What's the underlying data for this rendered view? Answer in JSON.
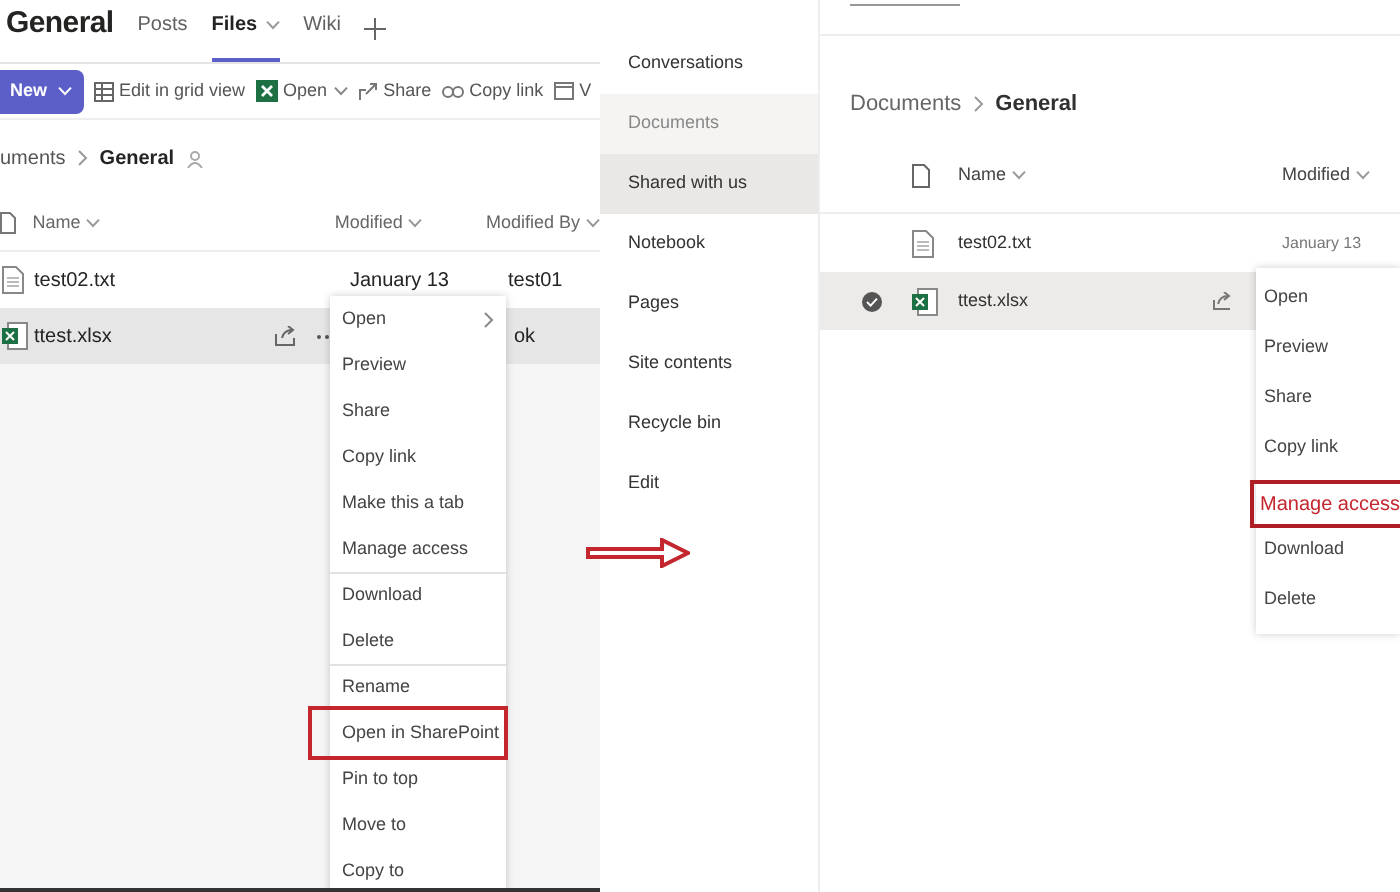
{
  "teams_view": {
    "channel": "General",
    "tabs": [
      {
        "label": "Posts",
        "selected": false,
        "has_menu": false
      },
      {
        "label": "Files",
        "selected": true,
        "has_menu": true
      },
      {
        "label": "Wiki",
        "selected": false,
        "has_menu": false
      }
    ],
    "toolbar": [
      {
        "kind": "primary",
        "label": "New",
        "has_menu": true
      },
      {
        "kind": "grid",
        "label": "Edit in grid view",
        "has_menu": false
      },
      {
        "kind": "excel",
        "label": "Open",
        "has_menu": true
      },
      {
        "kind": "share",
        "label": "Share",
        "has_menu": false
      },
      {
        "kind": "link",
        "label": "Copy link",
        "has_menu": false
      },
      {
        "kind": "window",
        "label": "V",
        "has_menu": false
      }
    ],
    "breadcrumb": {
      "parent": "uments",
      "current": "General"
    },
    "columns": [
      "Name",
      "Modified",
      "Modified By"
    ],
    "rows": [
      {
        "kind": "text",
        "name": "test02.txt",
        "modified": "January 13",
        "modified_by": "test01",
        "selected": false
      },
      {
        "kind": "excel",
        "name": "ttest.xlsx",
        "modified_by": "ok",
        "selected": true
      }
    ],
    "context_menu": [
      {
        "label": "Open",
        "submenu": true,
        "divider_before": false,
        "highlighted": false
      },
      {
        "label": "Preview",
        "submenu": false,
        "divider_before": false,
        "highlighted": false
      },
      {
        "label": "Share",
        "submenu": false,
        "divider_before": false,
        "highlighted": false
      },
      {
        "label": "Copy link",
        "submenu": false,
        "divider_before": false,
        "highlighted": false
      },
      {
        "label": "Make this a tab",
        "submenu": false,
        "divider_before": false,
        "highlighted": false
      },
      {
        "label": "Manage access",
        "submenu": false,
        "divider_before": false,
        "highlighted": false
      },
      {
        "label": "Download",
        "submenu": false,
        "divider_before": true,
        "highlighted": false
      },
      {
        "label": "Delete",
        "submenu": false,
        "divider_before": false,
        "highlighted": false
      },
      {
        "label": "Rename",
        "submenu": false,
        "divider_before": true,
        "highlighted": false
      },
      {
        "label": "Open in SharePoint",
        "submenu": false,
        "divider_before": false,
        "highlighted": true
      },
      {
        "label": "Pin to top",
        "submenu": false,
        "divider_before": false,
        "highlighted": false
      },
      {
        "label": "Move to",
        "submenu": false,
        "divider_before": false,
        "highlighted": false
      },
      {
        "label": "Copy to",
        "submenu": false,
        "divider_before": false,
        "highlighted": false
      }
    ]
  },
  "sharepoint_nav": [
    {
      "label": "Conversations",
      "selected": false,
      "hovered": false
    },
    {
      "label": "Documents",
      "selected": false,
      "hovered": true
    },
    {
      "label": "Shared with us",
      "selected": true,
      "hovered": false
    },
    {
      "label": "Notebook",
      "selected": false,
      "hovered": false
    },
    {
      "label": "Pages",
      "selected": false,
      "hovered": false
    },
    {
      "label": "Site contents",
      "selected": false,
      "hovered": false
    },
    {
      "label": "Recycle bin",
      "selected": false,
      "hovered": false
    },
    {
      "label": "Edit",
      "selected": false,
      "hovered": false
    }
  ],
  "sharepoint_view": {
    "breadcrumb": {
      "parent": "Documents",
      "current": "General"
    },
    "columns": [
      "Name",
      "Modified"
    ],
    "rows": [
      {
        "kind": "text",
        "name": "test02.txt",
        "modified": "January 13",
        "selected": false
      },
      {
        "kind": "excel",
        "name": "ttest.xlsx",
        "selected": true
      }
    ],
    "context_menu": [
      {
        "label": "Open",
        "highlighted": false
      },
      {
        "label": "Preview",
        "highlighted": false
      },
      {
        "label": "Share",
        "highlighted": false
      },
      {
        "label": "Copy link",
        "highlighted": false
      },
      {
        "label": "Manage access",
        "highlighted": true
      },
      {
        "label": "Download",
        "highlighted": false
      },
      {
        "label": "Delete",
        "highlighted": false
      }
    ]
  }
}
